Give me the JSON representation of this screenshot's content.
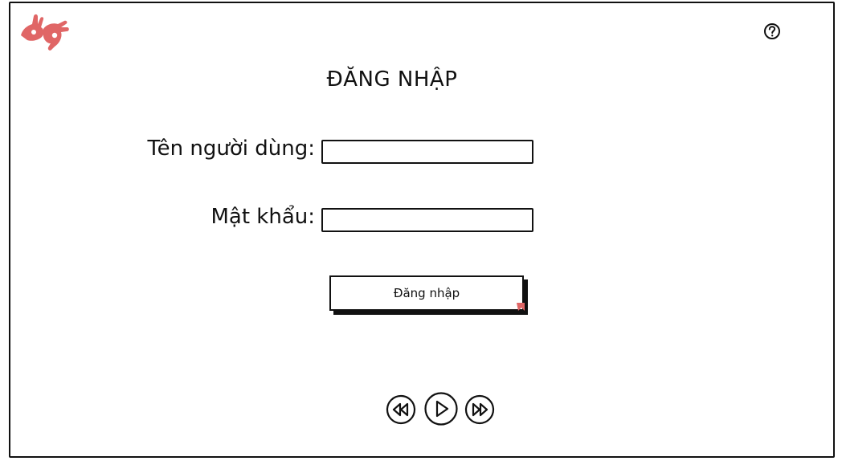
{
  "header": {
    "logo_icon": "sign-language-hands-icon",
    "help_icon": "question-circle-icon"
  },
  "form": {
    "title": "ĐĂNG NHẬP",
    "username_label": "Tên người dùng:",
    "username_value": "",
    "password_label": "Mật khẩu:",
    "password_value": "",
    "submit_label": "Đăng nhập"
  },
  "media_controls": {
    "rewind_icon": "rewind-icon",
    "play_icon": "play-icon",
    "fast_forward_icon": "fast-forward-icon"
  },
  "colors": {
    "accent": "#e06666",
    "ink": "#111111",
    "background": "#ffffff"
  }
}
